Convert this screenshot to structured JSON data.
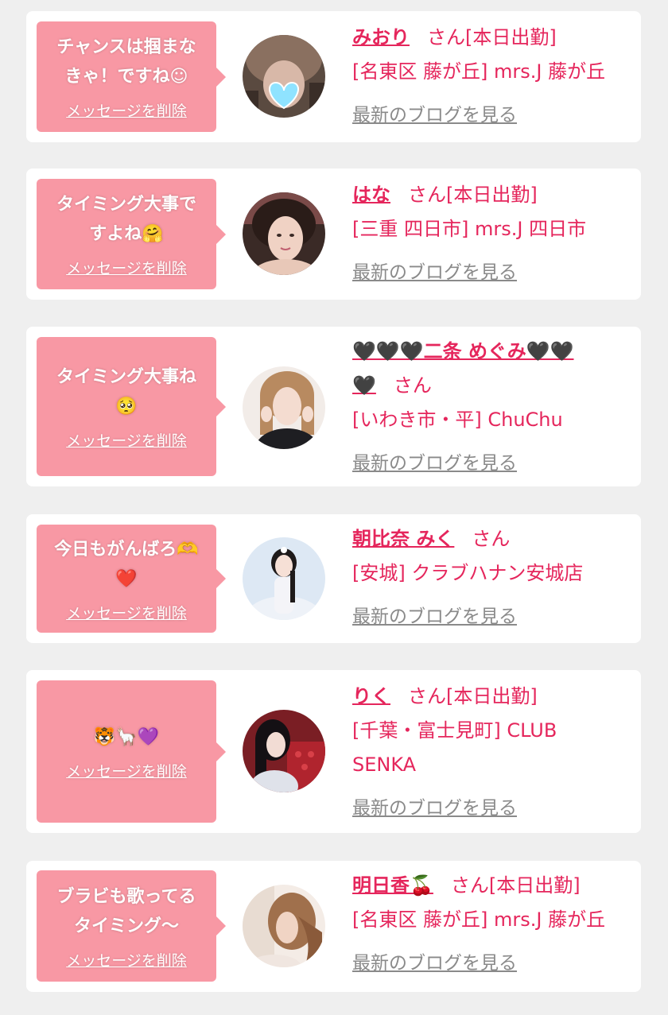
{
  "delete_label": "メッセージを削除",
  "blog_label": "最新のブログを見る",
  "san_suffix": "さん",
  "cards": [
    {
      "message": "チャンスは掴まな\nきゃ！ですね☺",
      "name": "みおり",
      "status": "[本日出勤]",
      "shop": "[名東区 藤が丘] mrs.J 藤が丘"
    },
    {
      "message": "タイミング大事で\nすよね🤗",
      "name": "はな",
      "status": "[本日出勤]",
      "shop": "[三重 四日市] mrs.J 四日市"
    },
    {
      "message": "タイミング大事ね\n🥺",
      "name": "🖤🖤🖤二条 めぐみ🖤🖤",
      "name_cont": "🖤",
      "status": "",
      "shop": "[いわき市・平] ChuChu"
    },
    {
      "message": "今日もがんばろ🫶\n❤️",
      "name": "朝比奈 みく",
      "status": "",
      "shop": "[安城] クラブハナン安城店"
    },
    {
      "message": "🐯🦙💜",
      "name": "りく",
      "status": "[本日出勤]",
      "shop": "[千葉・富士見町] CLUB SENKA"
    },
    {
      "message": "ブラビも歌ってる\nタイミング〜",
      "name": "明日香🍒",
      "status": "[本日出勤]",
      "shop": "[名東区 藤が丘] mrs.J 藤が丘"
    }
  ],
  "colors": {
    "background": "#efefef",
    "card": "#ffffff",
    "bubble": "#f898a4",
    "accent": "#e5265c",
    "link_gray": "#8a8a8a"
  }
}
